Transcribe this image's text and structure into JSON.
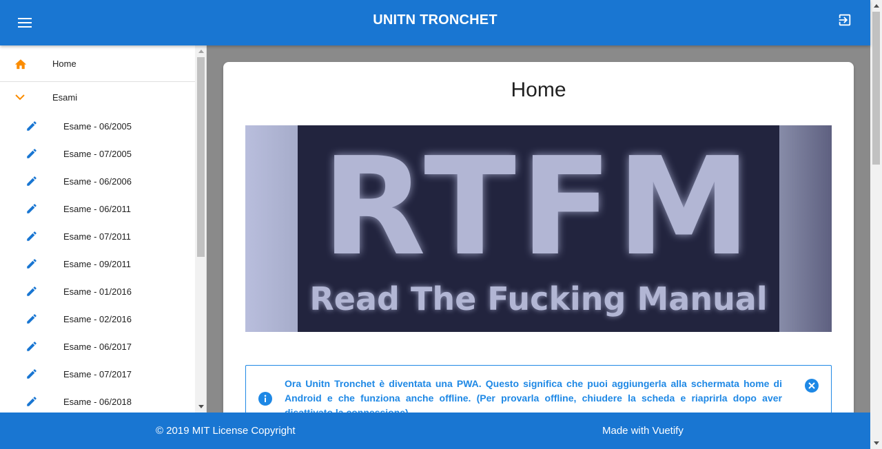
{
  "appbar": {
    "title": "UNITN TRONCHET",
    "menu_icon": "menu-icon",
    "logout_icon": "logout-icon"
  },
  "nav": {
    "home_label": "Home",
    "group_label": "Esami",
    "exams": [
      "Esame - 06/2005",
      "Esame - 07/2005",
      "Esame - 06/2006",
      "Esame - 06/2011",
      "Esame - 07/2011",
      "Esame - 09/2011",
      "Esame - 01/2016",
      "Esame - 02/2016",
      "Esame - 06/2017",
      "Esame - 07/2017",
      "Esame - 06/2018"
    ]
  },
  "main": {
    "title": "Home",
    "banner_big": "RTFM",
    "banner_sub": "Read The Fucking Manual",
    "alert_text": "Ora Unitn Tronchet è diventata una PWA. Questo significa che puoi aggiungerla alla schermata home di Android e che funziona anche offline. (Per provarla offline, chiudere la scheda e riaprirla dopo aver disattivato la connessione)"
  },
  "footer": {
    "left": "© 2019 MIT License Copyright",
    "right": "Made with Vuetify"
  },
  "colors": {
    "primary": "#1976d2",
    "accent_orange": "#fb8c00",
    "info_blue": "#1e88e5",
    "main_bg": "#8a8a8a"
  }
}
